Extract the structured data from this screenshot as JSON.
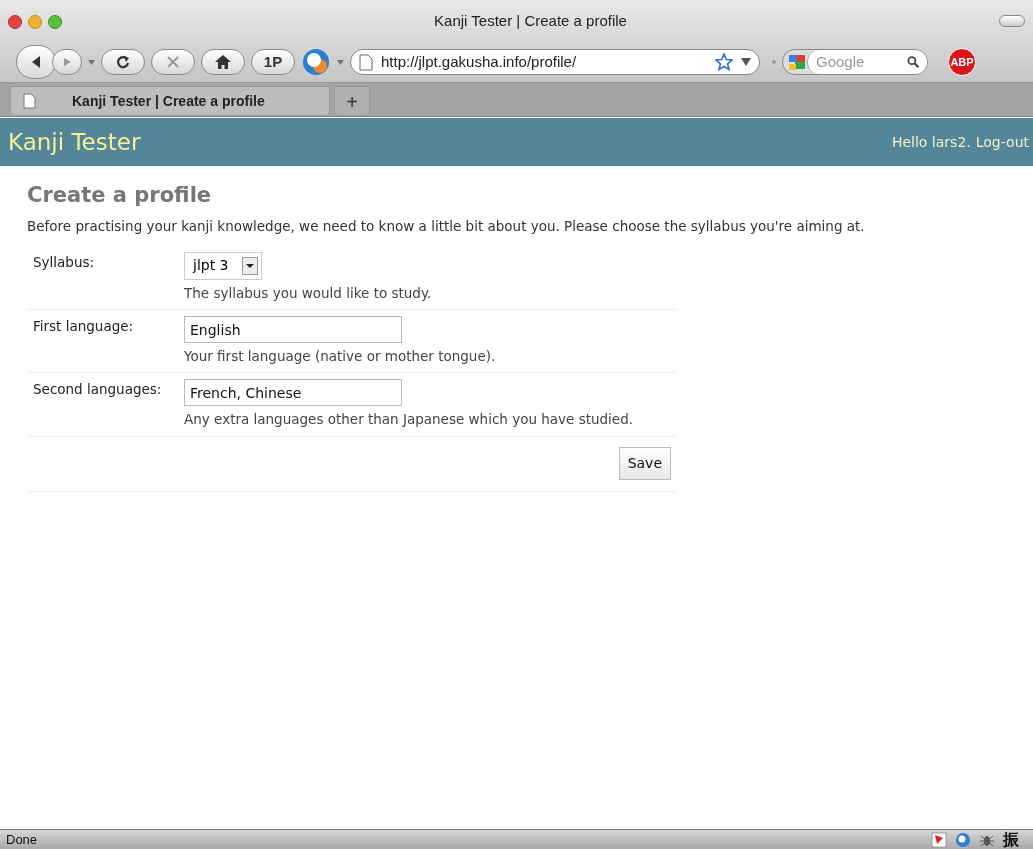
{
  "window": {
    "title": "Kanji Tester | Create a profile"
  },
  "toolbar": {
    "one_password_label": "1P",
    "url": "http://jlpt.gakusha.info/profile/",
    "search_placeholder": "Google",
    "adblock_label": "ABP"
  },
  "tabs": [
    {
      "label": "Kanji Tester | Create a profile",
      "selected": true
    }
  ],
  "new_tab": "+",
  "header": {
    "site_title": "Kanji Tester",
    "greeting": "Hello lars2.",
    "logout": "Log-out"
  },
  "page": {
    "heading": "Create a profile",
    "intro": "Before practising your kanji knowledge, we need to know a little bit about you. Please choose the syllabus you're aiming at.",
    "fields": [
      {
        "kind": "select",
        "label": "Syllabus:",
        "value": "jlpt 3",
        "help": "The syllabus you would like to study."
      },
      {
        "kind": "text",
        "label": "First language:",
        "value": "English",
        "help": "Your first language (native or mother tongue)."
      },
      {
        "kind": "text",
        "label": "Second languages:",
        "value": "French, Chinese",
        "help": "Any extra languages other than Japanese which you have studied."
      }
    ],
    "save": "Save"
  },
  "status_bar": {
    "text": "Done",
    "glyph": "振"
  }
}
